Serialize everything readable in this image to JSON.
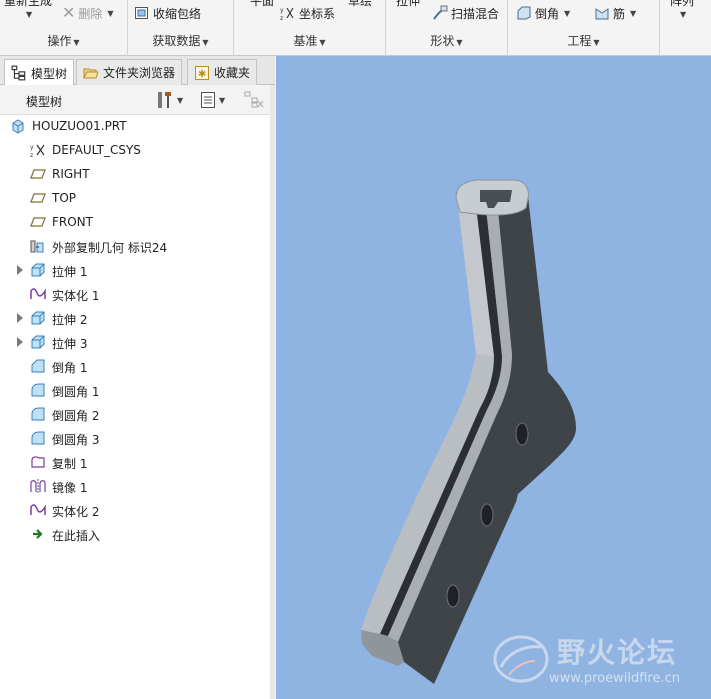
{
  "ribbon": {
    "cut_labels": {
      "regenerate": "重新生成",
      "plane": "平面",
      "sketch": "草绘",
      "extrude": "拉伸",
      "pattern": "阵列"
    },
    "buttons": {
      "delete": "删除",
      "shrinkwrap": "收缩包络",
      "csys": "坐标系",
      "sweep_blend": "扫描混合",
      "chamfer": "倒角",
      "rib": "筋"
    },
    "groups": {
      "operations": "操作",
      "get_data": "获取数据",
      "datum": "基准",
      "shapes": "形状",
      "engineering": "工程"
    }
  },
  "tabs": {
    "model_tree": "模型树",
    "folder_browser": "文件夹浏览器",
    "favorites": "收藏夹"
  },
  "tree": {
    "header": "模型树",
    "items": [
      {
        "label": "HOUZUO01.PRT",
        "icon": "part-icon",
        "expandable": false,
        "indent": 0
      },
      {
        "label": "DEFAULT_CSYS",
        "icon": "csys-icon",
        "expandable": false,
        "indent": 1
      },
      {
        "label": "RIGHT",
        "icon": "datum-plane-icon",
        "expandable": false,
        "indent": 1
      },
      {
        "label": "TOP",
        "icon": "datum-plane-icon",
        "expandable": false,
        "indent": 1
      },
      {
        "label": "FRONT",
        "icon": "datum-plane-icon",
        "expandable": false,
        "indent": 1
      },
      {
        "label": "外部复制几何 标识24",
        "icon": "external-copy-geometry-icon",
        "expandable": false,
        "indent": 1
      },
      {
        "label": "拉伸 1",
        "icon": "extrude-icon",
        "expandable": true,
        "indent": 1
      },
      {
        "label": "实体化 1",
        "icon": "solidify-icon",
        "expandable": false,
        "indent": 1
      },
      {
        "label": "拉伸 2",
        "icon": "extrude-icon",
        "expandable": true,
        "indent": 1
      },
      {
        "label": "拉伸 3",
        "icon": "extrude-icon",
        "expandable": true,
        "indent": 1
      },
      {
        "label": "倒角 1",
        "icon": "chamfer-icon",
        "expandable": false,
        "indent": 1
      },
      {
        "label": "倒圆角 1",
        "icon": "round-icon",
        "expandable": false,
        "indent": 1
      },
      {
        "label": "倒圆角 2",
        "icon": "round-icon",
        "expandable": false,
        "indent": 1
      },
      {
        "label": "倒圆角 3",
        "icon": "round-icon",
        "expandable": false,
        "indent": 1
      },
      {
        "label": "复制 1",
        "icon": "copy-icon",
        "expandable": false,
        "indent": 1
      },
      {
        "label": "镜像 1",
        "icon": "mirror-icon",
        "expandable": false,
        "indent": 1
      },
      {
        "label": "实体化 2",
        "icon": "solidify-icon",
        "expandable": false,
        "indent": 1
      },
      {
        "label": "在此插入",
        "icon": "insert-here-arrow-icon",
        "expandable": false,
        "indent": 1
      }
    ]
  },
  "watermark": {
    "text": "野火论坛",
    "url": "www.proewildfire.cn"
  },
  "colors": {
    "viewport_bg": "#8fb4e2",
    "part_light": "#b9bec3",
    "part_dark": "#3f4449"
  }
}
